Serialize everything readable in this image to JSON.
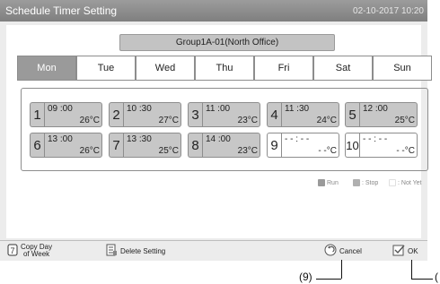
{
  "title": "Schedule Timer Setting",
  "datetime": "02-10-2017  10:20",
  "group": "Group1A-01(North Office)",
  "tabs": [
    {
      "label": "Mon",
      "active": true
    },
    {
      "label": "Tue",
      "active": false
    },
    {
      "label": "Wed",
      "active": false
    },
    {
      "label": "Thu",
      "active": false
    },
    {
      "label": "Fri",
      "active": false
    },
    {
      "label": "Sat",
      "active": false
    },
    {
      "label": "Sun",
      "active": false
    }
  ],
  "slots": [
    {
      "num": "1",
      "time": "09 :00",
      "temp": "26°C",
      "state": "run"
    },
    {
      "num": "2",
      "time": "10 :30",
      "temp": "27°C",
      "state": "run"
    },
    {
      "num": "3",
      "time": "11 :00",
      "temp": "23°C",
      "state": "run"
    },
    {
      "num": "4",
      "time": "11 :30",
      "temp": "24°C",
      "state": "run"
    },
    {
      "num": "5",
      "time": "12 :00",
      "temp": "25°C",
      "state": "run"
    },
    {
      "num": "6",
      "time": "13 :00",
      "temp": "26°C",
      "state": "run"
    },
    {
      "num": "7",
      "time": "13 :30",
      "temp": "25°C",
      "state": "run"
    },
    {
      "num": "8",
      "time": "14 :00",
      "temp": "23°C",
      "state": "run"
    },
    {
      "num": "9",
      "time": "- - : - -",
      "temp": "- -°C",
      "state": "notyet"
    },
    {
      "num": "10",
      "time": "- - : - -",
      "temp": "- -°C",
      "state": "notyet"
    }
  ],
  "legend": {
    "run": "Run",
    "stop": ": Stop",
    "notyet": ": Not Yet"
  },
  "footer": {
    "copy_line1": "Copy Day",
    "copy_line2": "of Week",
    "delete": "Delete Setting",
    "cancel": "Cancel",
    "ok": "OK"
  },
  "callouts": {
    "cancel": "(9)",
    "ok": "("
  },
  "colors": {
    "titlebar": "#8a8a8a",
    "active_tab": "#9a9a9a",
    "slot_fill": "#c7c7c7",
    "stop": "#b0b0b0"
  }
}
